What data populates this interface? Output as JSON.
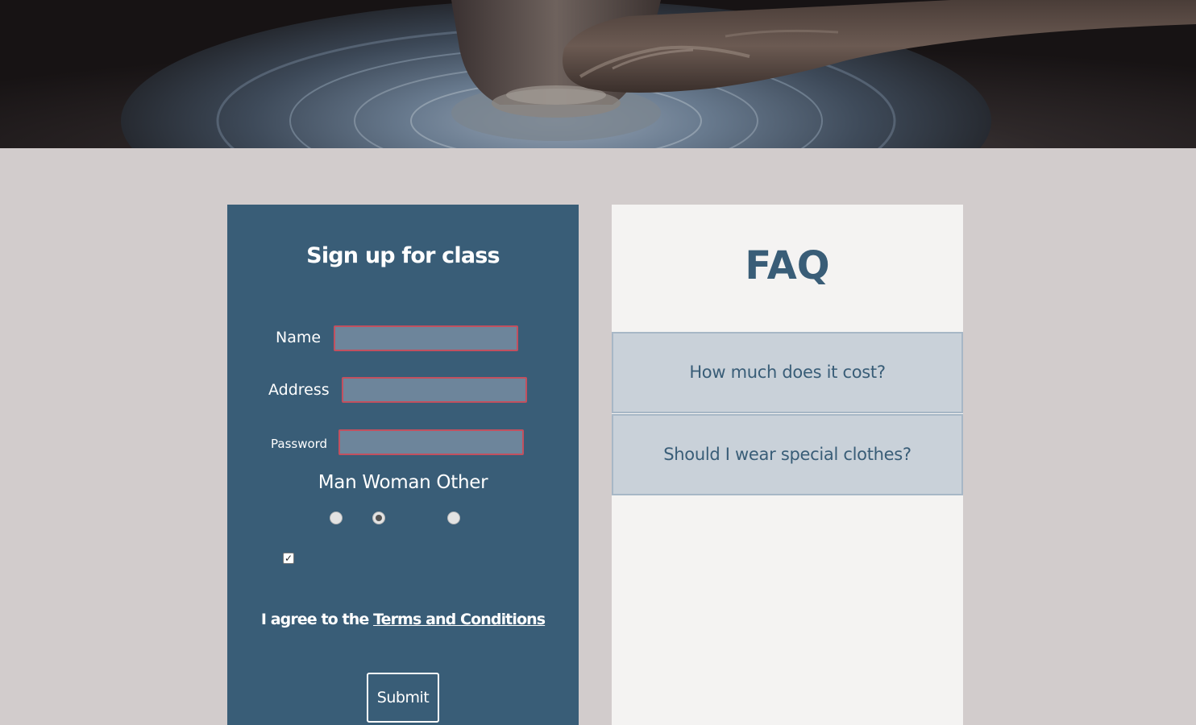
{
  "hero": {
    "image": "pottery-wheel-hands-photo"
  },
  "signup": {
    "title": "Sign up for class",
    "name_label": "Name",
    "name_value": "",
    "address_label": "Address",
    "address_value": "",
    "password_label": "Password",
    "password_value": "",
    "gender_labels": "Man Woman Other",
    "gender_options": [
      "Man",
      "Woman",
      "Other"
    ],
    "gender_selected": "Woman",
    "terms_checked": true,
    "agree_prefix": "I agree to the",
    "terms_link": "Terms and Conditions",
    "submit_label": "Submit"
  },
  "faq": {
    "title": "FAQ",
    "items": [
      {
        "question": "How much does it cost?"
      },
      {
        "question": "Should I wear special clothes?"
      }
    ]
  },
  "colors": {
    "page_background": "#d2cccc",
    "form_panel": "#395d77",
    "input_fill": "#6d859b",
    "input_border": "#c2505f",
    "faq_panel": "#f4f3f2",
    "faq_item": "#c9d1d9",
    "faq_text": "#395d77"
  }
}
